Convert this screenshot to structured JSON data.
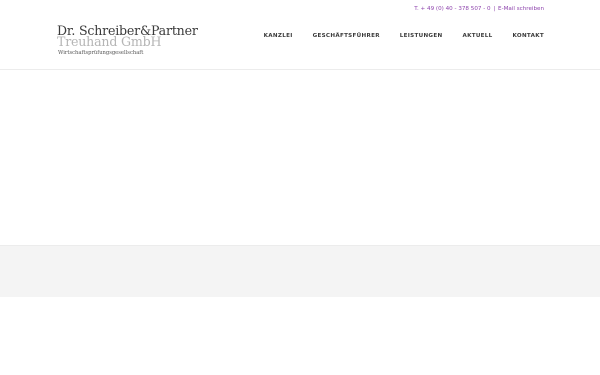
{
  "topbar": {
    "phone": "T. + 49 (0) 40 - 378 507 - 0",
    "separator": "|",
    "email_link": "E-Mail schreiben"
  },
  "logo": {
    "line1": "Dr. Schreiber&Partner",
    "line2": "Treuhand GmbH",
    "line3": "Wirtschaftsprüfungsgesellschaft"
  },
  "nav": {
    "items": [
      {
        "label": "KANZLEI"
      },
      {
        "label": "GESCHÄFTSFÜHRER"
      },
      {
        "label": "LEISTUNGEN"
      },
      {
        "label": "AKTUELL"
      },
      {
        "label": "KONTAKT"
      }
    ]
  },
  "colors": {
    "accent": "#8e44ad",
    "text": "#3a3a3a",
    "band": "#f4f4f4"
  }
}
